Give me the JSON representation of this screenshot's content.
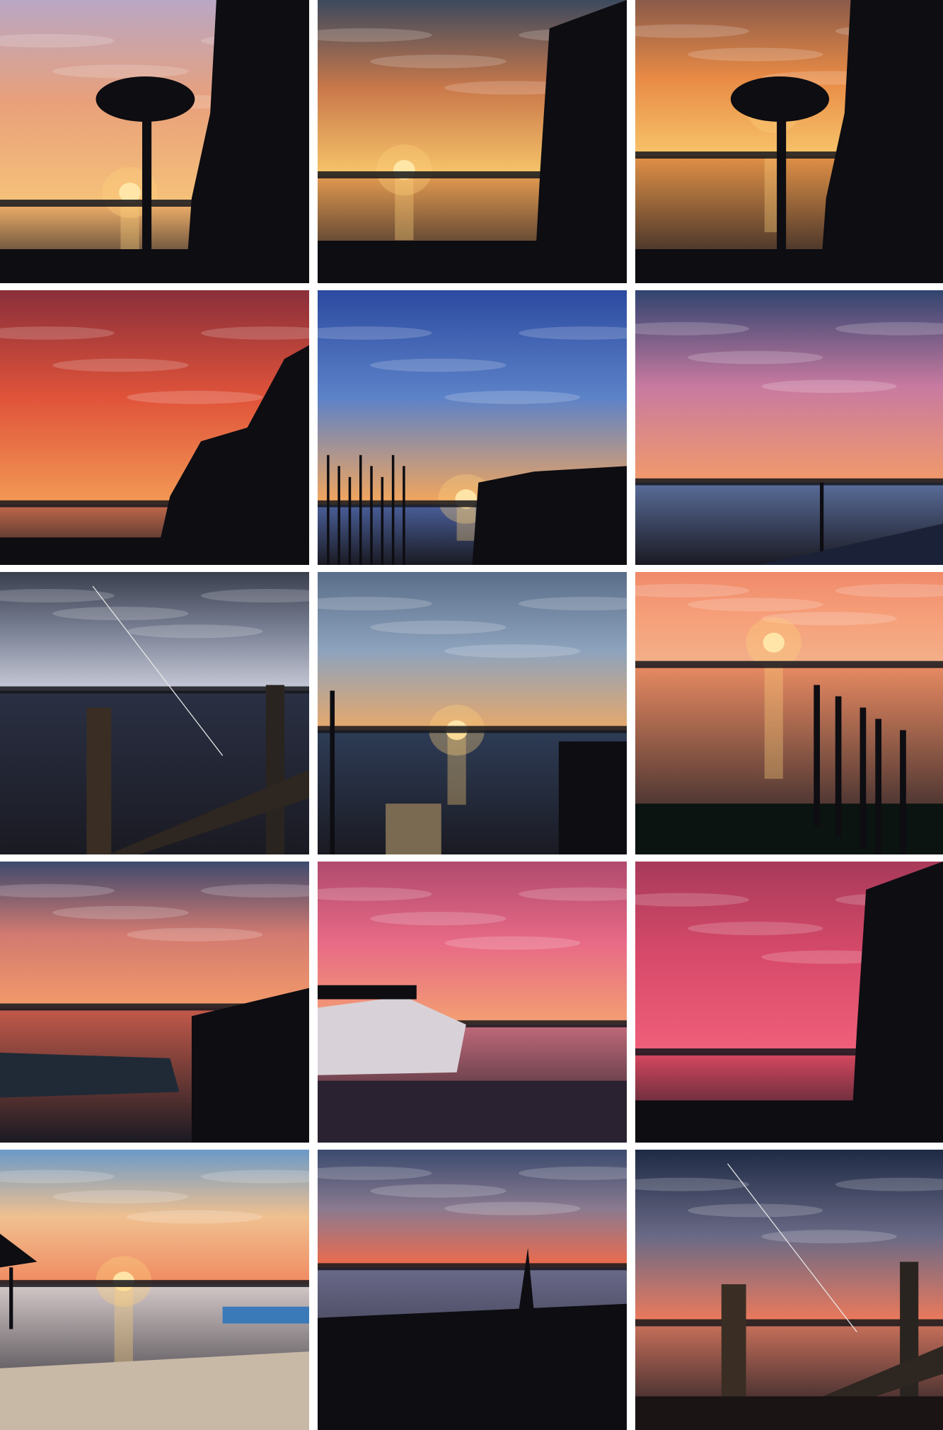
{
  "gallery": {
    "columns": 3,
    "rows": 5,
    "tiles": [
      {
        "scene": "palm-silhouette-lake-sunset",
        "sky": [
          "#b9a7c5",
          "#e8a07a",
          "#f6c27a"
        ],
        "water": "#f0b06a"
      },
      {
        "scene": "sun-behind-trees-reflection",
        "sky": [
          "#3c4a5e",
          "#c9784a",
          "#f7c56a"
        ],
        "water": "#e39a50"
      },
      {
        "scene": "palm-frond-golden-horizon",
        "sky": [
          "#8a5a4a",
          "#e88a45",
          "#f7c46a"
        ],
        "water": "#e29146"
      },
      {
        "scene": "red-streaked-sky-treeline",
        "sky": [
          "#8a2f3a",
          "#e0533a",
          "#f39a55"
        ],
        "water": "#c26a4a"
      },
      {
        "scene": "blue-sky-sunset-reeds",
        "sky": [
          "#2c4aa0",
          "#5c82c8",
          "#f6a65a"
        ],
        "water": "#4a5f9a"
      },
      {
        "scene": "pastel-clouds-beach",
        "sky": [
          "#30446f",
          "#c87aa0",
          "#f29a6a"
        ],
        "water": "#5a6d9a"
      },
      {
        "scene": "storm-clouds-dock-reflection",
        "sky": [
          "#3a3f4e",
          "#7c8296",
          "#c8cbd8"
        ],
        "water": "#2a3044"
      },
      {
        "scene": "dusk-blue-clouds-dock",
        "sky": [
          "#5a6e8a",
          "#8ea3bd",
          "#e8a86a"
        ],
        "water": "#2e3c56"
      },
      {
        "scene": "orange-lake-stumps",
        "sky": [
          "#f08a6a",
          "#f6a07a",
          "#f2b08a"
        ],
        "water": "#e88a62"
      },
      {
        "scene": "cloudy-sunset-boat-dock",
        "sky": [
          "#3e4a6e",
          "#d27a70",
          "#f39a6a"
        ],
        "water": "#c45a4a"
      },
      {
        "scene": "pink-sky-boat-trailer",
        "sky": [
          "#b04a6e",
          "#e86a86",
          "#f3a072"
        ],
        "water": "#c06a7a"
      },
      {
        "scene": "magenta-sky-reflection",
        "sky": [
          "#a83a5a",
          "#d84a6a",
          "#f0607a"
        ],
        "water": "#d84860"
      },
      {
        "scene": "twilight-sun-lake-shore",
        "sky": [
          "#6a9ac8",
          "#f0c090",
          "#f08a60"
        ],
        "water": "#d4c8c8"
      },
      {
        "scene": "dusk-horizon-grass",
        "sky": [
          "#3a4a6e",
          "#8a7a90",
          "#f06a4a"
        ],
        "water": "#6a6a8a"
      },
      {
        "scene": "night-dock-fishing-line",
        "sky": [
          "#1e2a44",
          "#6a6a86",
          "#f07a5a"
        ],
        "water": "#c8705a"
      }
    ]
  }
}
